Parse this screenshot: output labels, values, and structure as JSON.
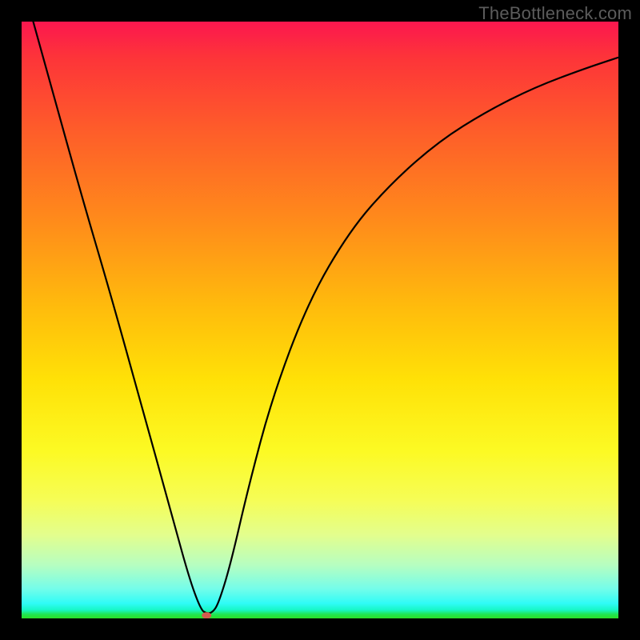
{
  "watermark": "TheBottleneck.com",
  "chart_data": {
    "type": "line",
    "title": "",
    "xlabel": "",
    "ylabel": "",
    "xlim": [
      0,
      100
    ],
    "ylim": [
      0,
      100
    ],
    "grid": false,
    "legend": false,
    "series": [
      {
        "name": "curve",
        "x": [
          0,
          5,
          10,
          15,
          20,
          25,
          28,
          30,
          31,
          32,
          33,
          35,
          38,
          42,
          48,
          55,
          62,
          70,
          78,
          86,
          94,
          100
        ],
        "values": [
          107,
          89,
          71,
          54,
          36,
          18,
          7,
          1.5,
          0.8,
          1.0,
          2.5,
          9,
          22,
          37,
          53,
          65,
          73,
          80,
          85,
          89,
          92,
          94
        ]
      }
    ],
    "marker": {
      "x": 31,
      "y": 0.5
    },
    "background": {
      "type": "vertical-gradient",
      "stops": [
        {
          "pos": 0,
          "color": "#fc174f"
        },
        {
          "pos": 0.06,
          "color": "#fd3439"
        },
        {
          "pos": 0.18,
          "color": "#fe5c2a"
        },
        {
          "pos": 0.34,
          "color": "#ff8d1a"
        },
        {
          "pos": 0.48,
          "color": "#ffbc0c"
        },
        {
          "pos": 0.6,
          "color": "#ffe107"
        },
        {
          "pos": 0.72,
          "color": "#fcfa24"
        },
        {
          "pos": 0.8,
          "color": "#f6fd55"
        },
        {
          "pos": 0.86,
          "color": "#e3fe8d"
        },
        {
          "pos": 0.91,
          "color": "#b7fec0"
        },
        {
          "pos": 0.95,
          "color": "#75fde9"
        },
        {
          "pos": 0.975,
          "color": "#2ffbf6"
        },
        {
          "pos": 0.986,
          "color": "#17f7c5"
        },
        {
          "pos": 0.993,
          "color": "#21e654"
        },
        {
          "pos": 1.0,
          "color": "#2adf26"
        }
      ]
    }
  }
}
